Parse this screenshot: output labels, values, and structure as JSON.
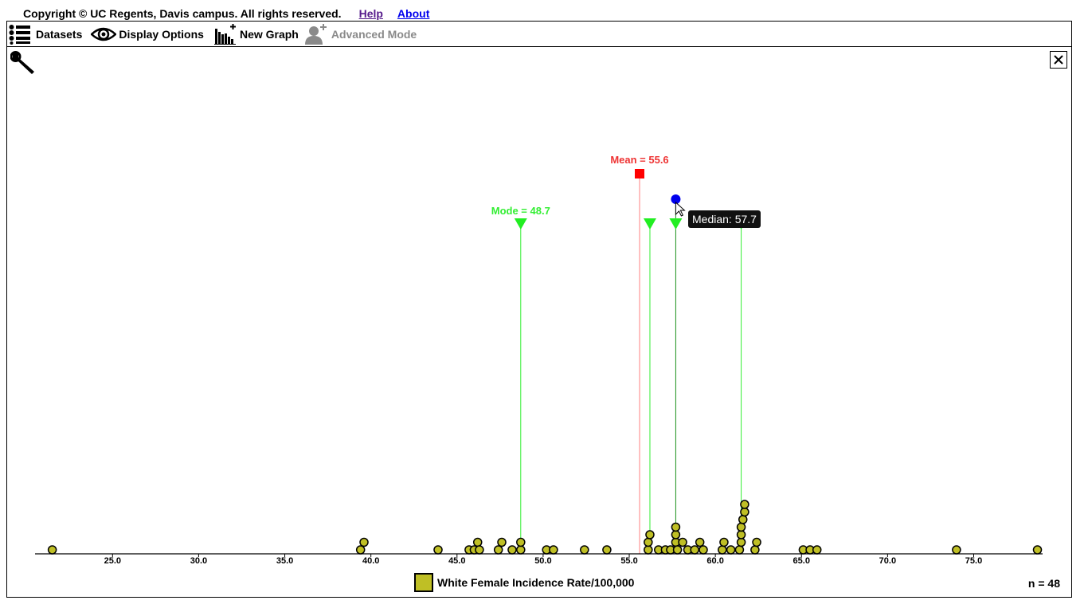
{
  "header": {
    "copyright": "Copyright © UC Regents, Davis campus. All rights reserved.",
    "help_link": "Help",
    "about_link": "About"
  },
  "toolbar": {
    "datasets": "Datasets",
    "display_options": "Display Options",
    "new_graph": "New Graph",
    "advanced_mode": "Advanced Mode"
  },
  "panel": {
    "close_glyph": "✕"
  },
  "chart_data": {
    "type": "dotplot",
    "xlim": [
      20.5,
      79.0
    ],
    "ticks": [
      25,
      30,
      35,
      40,
      45,
      50,
      55,
      60,
      65,
      70,
      75
    ],
    "tick_labels": [
      "25.0",
      "30.0",
      "35.0",
      "40.0",
      "45.0",
      "50.0",
      "55.0",
      "60.0",
      "65.0",
      "70.0",
      "75.0"
    ],
    "series_name": "White Female Incidence Rate/100,000",
    "n_label": "n = 48",
    "point_color": "#bfbf25",
    "points": [
      21.5,
      39.4,
      39.6,
      43.9,
      45.7,
      46.0,
      46.2,
      46.3,
      47.4,
      47.6,
      48.2,
      48.7,
      48.7,
      50.2,
      50.6,
      52.4,
      53.7,
      56.1,
      56.1,
      56.2,
      56.7,
      57.1,
      57.4,
      57.7,
      57.7,
      57.7,
      57.8,
      58.1,
      58.4,
      58.8,
      59.1,
      59.3,
      60.4,
      60.5,
      60.9,
      61.4,
      61.5,
      61.5,
      61.5,
      61.6,
      61.7,
      61.7,
      62.3,
      62.4,
      65.1,
      65.5,
      65.9,
      74.0,
      78.7
    ],
    "mean": {
      "value": 55.6,
      "label": "Mean = 55.6",
      "color": "#ee3333"
    },
    "mode": {
      "value": 48.7,
      "label": "Mode = 48.7",
      "color": "#33ee33"
    },
    "median": {
      "value": 57.7,
      "label": "Median: 57.7",
      "color": "#0000ee"
    },
    "extra_markers": [
      56.2,
      61.5
    ]
  }
}
